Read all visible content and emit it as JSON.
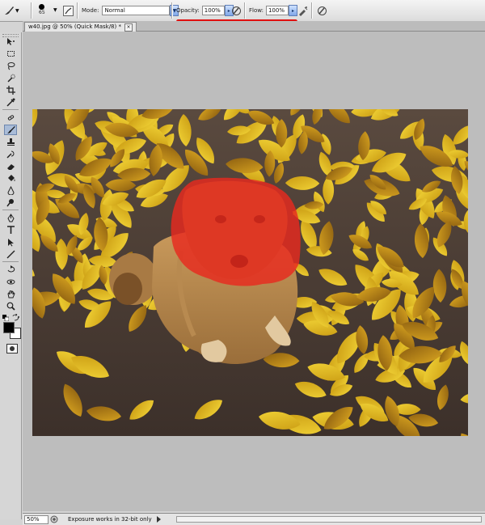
{
  "options_bar": {
    "brush_size": "65",
    "mode_label": "Mode:",
    "mode_value": "Normal",
    "opacity_label": "Opacity:",
    "opacity_value": "100%",
    "flow_label": "Flow:",
    "flow_value": "100%"
  },
  "document": {
    "tab_title": "w40.jpg @ 50% (Quick Mask/8) *",
    "tab_close": "×"
  },
  "status_bar": {
    "zoom": "50%",
    "message": "Exposure works in 32-bit only"
  },
  "toolbar": {
    "tools": [
      "move-tool",
      "marquee-tool",
      "lasso-tool",
      "quick-selection-tool",
      "crop-tool",
      "eyedropper-tool",
      "spot-healing-tool",
      "brush-tool",
      "clone-stamp-tool",
      "history-brush-tool",
      "eraser-tool",
      "paint-bucket-tool",
      "blur-tool",
      "dodge-tool",
      "pen-tool",
      "type-tool",
      "path-selection-tool",
      "line-tool",
      "3d-rotate-tool",
      "3d-orbit-tool",
      "hand-tool",
      "zoom-tool"
    ],
    "active_tool": "brush-tool",
    "foreground_color": "#000000",
    "background_color": "#ffffff"
  },
  "quick_mask": {
    "overlay_color": "#e82a1e",
    "overlay_opacity": "50%"
  },
  "colors": {
    "annotation_line": "#e01010"
  }
}
